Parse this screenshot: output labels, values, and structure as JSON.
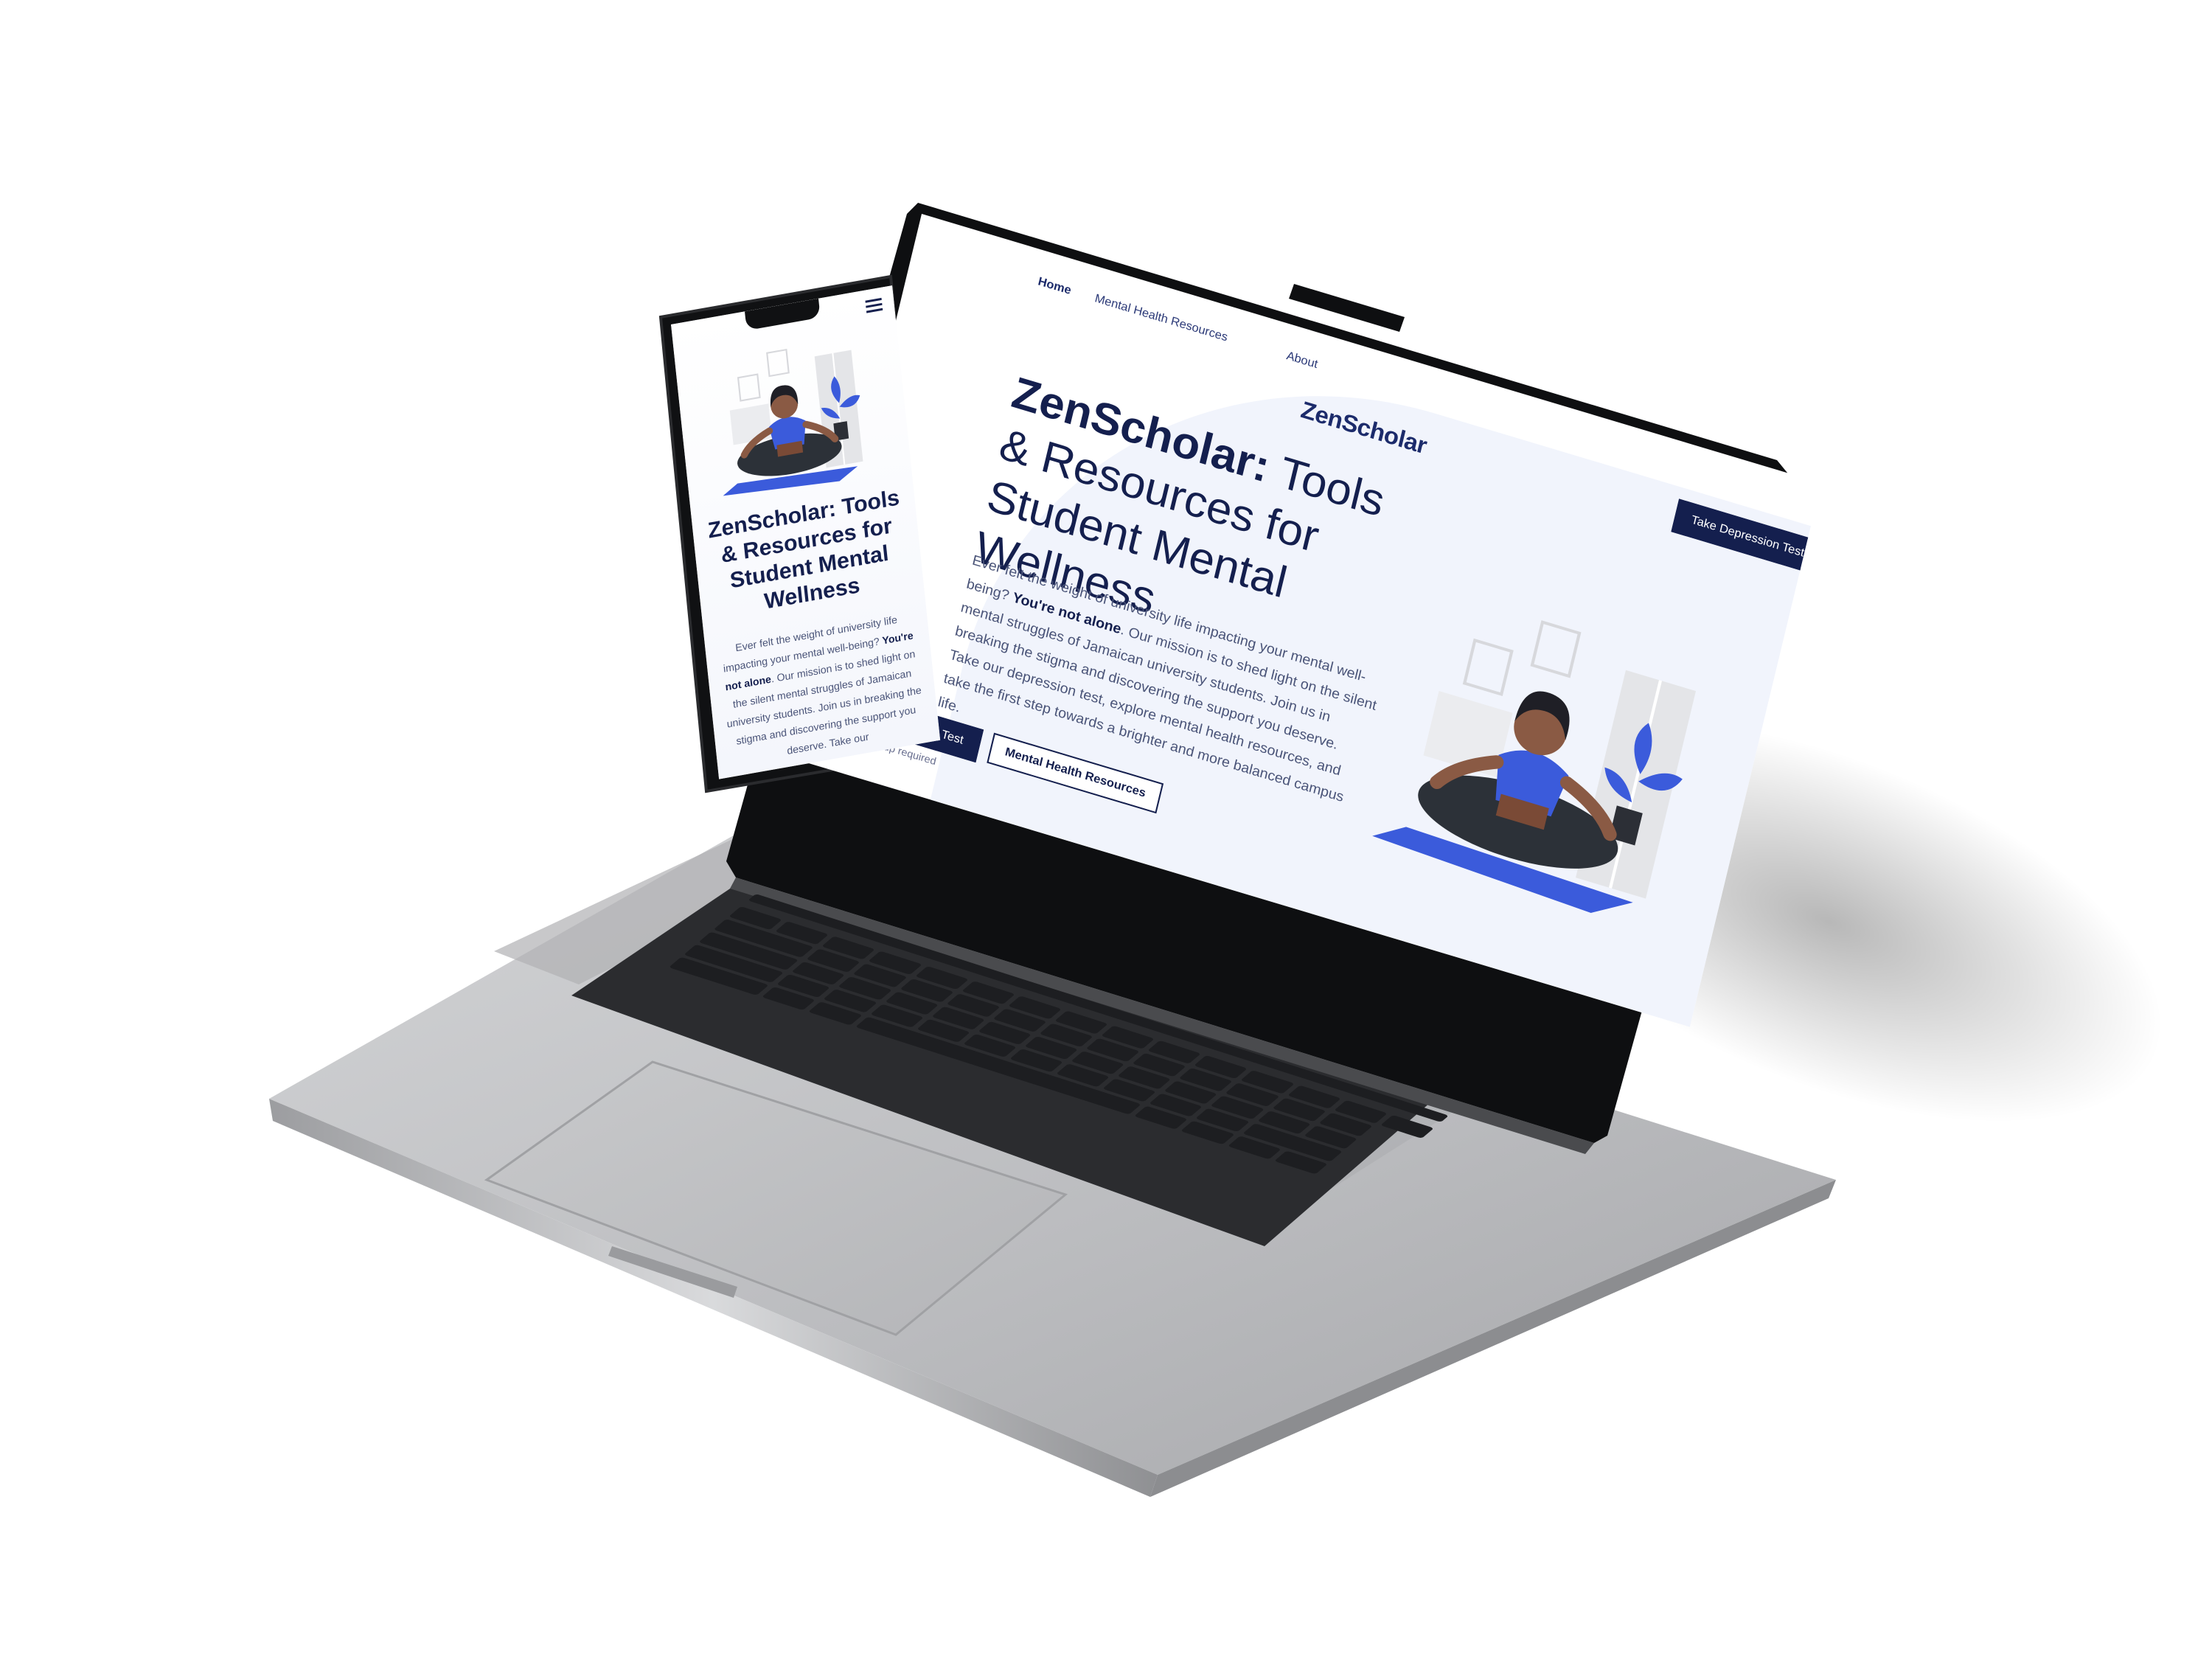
{
  "laptop": {
    "nav": {
      "home": "Home",
      "resources": "Mental Health Resources",
      "about": "About"
    },
    "brand": "ZenScholar",
    "header_cta": "Take Depression Test",
    "hero": {
      "title_bold": "ZenScholar:",
      "title_rest": " Tools & Resources for Student Mental Wellness",
      "desc_1": "Ever felt the weight of university life impacting your mental well-being? ",
      "desc_bold": "You're not alone",
      "desc_2": ". Our mission is to shed light on the silent mental struggles of Jamaican university students. Join us in breaking the stigma and discovering the support you deserve. Take our depression test, explore mental health resources, and take the first step towards a brighter and more balanced campus life.",
      "primary_button": "eening Test",
      "secondary_button": "Mental Health Resources",
      "note": "-up required"
    }
  },
  "phone": {
    "title_bold": "ZenScholar:",
    "title_rest": " Tools & Resources for Student Mental Wellness",
    "desc_1": "Ever felt the weight of university life impacting your mental well-being? ",
    "desc_bold": "You're not alone",
    "desc_2": ". Our mission is to shed light on the silent mental struggles of Jamaican university students. Join us in breaking the stigma and discovering the support you deserve. Take our"
  },
  "colors": {
    "brand_navy": "#141f4e",
    "accent_blue": "#3b5bdb",
    "hero_bg": "#f1f4fc",
    "laptop_silver": "#b9babd",
    "keyboard": "#1e1f22"
  },
  "icons": {
    "phone_menu": "hamburger-menu-icon",
    "illustration": "meditating-woman-illustration"
  }
}
